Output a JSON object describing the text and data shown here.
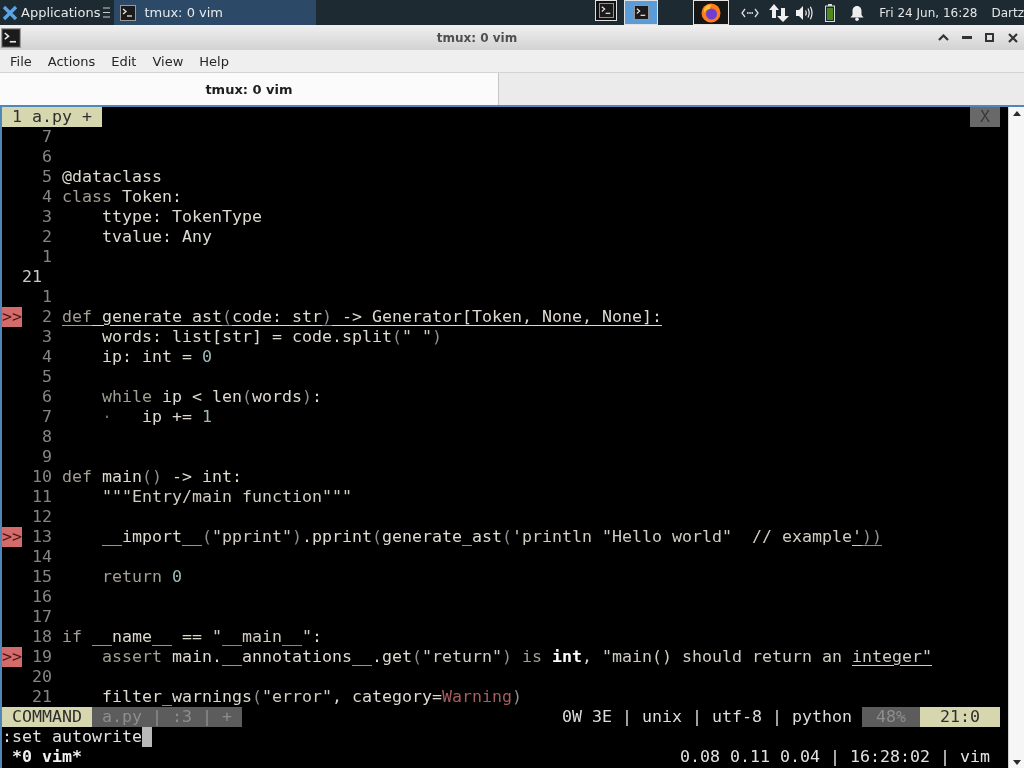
{
  "top_panel": {
    "applications_label": "Applications",
    "taskbar": [
      {
        "label": "tmux: 0 vim",
        "selected": true
      }
    ],
    "workspaces": [
      {
        "selected": false
      },
      {
        "selected": true
      }
    ],
    "clock": "Fri 24 Jun, 16:28",
    "user": "Dartz"
  },
  "window": {
    "title": "tmux: 0 vim"
  },
  "menu": [
    "File",
    "Actions",
    "Edit",
    "View",
    "Help"
  ],
  "tabs": [
    {
      "label": "tmux: 0 vim",
      "selected": true
    }
  ],
  "vim": {
    "tabline": {
      "tabs": [
        {
          "label": "1 a.py +",
          "selected": true
        }
      ],
      "close": "X"
    },
    "lines": [
      {
        "number": "7",
        "current": false
      },
      {
        "number": "6",
        "current": false
      },
      {
        "number": "5",
        "current": false,
        "tokens": [
          {
            "text": "@dataclass",
            "kind": "plain",
            "underline": false
          }
        ]
      },
      {
        "number": "4",
        "current": false,
        "tokens": [
          {
            "text": "class",
            "kind": "keyword",
            "underline": false
          },
          {
            "text": " Token:",
            "kind": "plain",
            "underline": false
          }
        ]
      },
      {
        "number": "3",
        "current": false,
        "tokens": [
          {
            "text": "    ttype: TokenType",
            "kind": "plain",
            "underline": false
          }
        ]
      },
      {
        "number": "2",
        "current": false,
        "tokens": [
          {
            "text": "    tvalue: Any",
            "kind": "plain",
            "underline": false
          }
        ]
      },
      {
        "number": "1",
        "current": false
      },
      {
        "number": "21",
        "current": true
      },
      {
        "number": "1",
        "current": false
      },
      {
        "sign": ">>",
        "number": "2",
        "current": false,
        "tokens": [
          {
            "text": "def",
            "kind": "keyword",
            "underline": true
          },
          {
            "text": " generate_ast",
            "kind": "plain",
            "underline": true
          },
          {
            "text": "(",
            "kind": "paren",
            "underline": true
          },
          {
            "text": "code: str",
            "kind": "plain",
            "underline": true
          },
          {
            "text": ")",
            "kind": "paren",
            "underline": true
          },
          {
            "text": " -> Generator[Token, None, None]:",
            "kind": "plain",
            "underline": true
          }
        ]
      },
      {
        "number": "3",
        "current": false,
        "tokens": [
          {
            "text": "    words: list[str] = code.split",
            "kind": "plain",
            "underline": false
          },
          {
            "text": "(",
            "kind": "paren",
            "underline": false
          },
          {
            "text": "\" \"",
            "kind": "string",
            "underline": false
          },
          {
            "text": ")",
            "kind": "paren",
            "underline": false
          }
        ]
      },
      {
        "number": "4",
        "current": false,
        "tokens": [
          {
            "text": "    ip: int = ",
            "kind": "plain",
            "underline": false
          },
          {
            "text": "0",
            "kind": "number",
            "underline": false
          }
        ]
      },
      {
        "number": "5",
        "current": false
      },
      {
        "number": "6",
        "current": false,
        "tokens": [
          {
            "text": "    while",
            "kind": "keyword",
            "underline": false
          },
          {
            "text": " ip < len",
            "kind": "plain",
            "underline": false
          },
          {
            "text": "(",
            "kind": "paren",
            "underline": false
          },
          {
            "text": "words",
            "kind": "plain",
            "underline": false
          },
          {
            "text": ")",
            "kind": "paren",
            "underline": false
          },
          {
            "text": ":",
            "kind": "plain",
            "underline": false
          }
        ]
      },
      {
        "number": "7",
        "current": false,
        "tokens": [
          {
            "text": "    ·",
            "kind": "listchar",
            "underline": false
          },
          {
            "text": "   ip += ",
            "kind": "plain",
            "underline": false
          },
          {
            "text": "1",
            "kind": "number",
            "underline": false
          }
        ]
      },
      {
        "number": "8",
        "current": false
      },
      {
        "number": "9",
        "current": false
      },
      {
        "number": "10",
        "current": false,
        "tokens": [
          {
            "text": "def",
            "kind": "keyword",
            "underline": false
          },
          {
            "text": " main",
            "kind": "plain",
            "underline": false
          },
          {
            "text": "()",
            "kind": "paren",
            "underline": false
          },
          {
            "text": " -> int:",
            "kind": "plain",
            "underline": false
          }
        ]
      },
      {
        "number": "11",
        "current": false,
        "tokens": [
          {
            "text": "    \"\"\"Entry/main function\"\"\"",
            "kind": "string",
            "underline": false
          }
        ]
      },
      {
        "number": "12",
        "current": false
      },
      {
        "sign": ">>",
        "number": "13",
        "current": false,
        "tokens": [
          {
            "text": "    __import__",
            "kind": "plain",
            "underline": false
          },
          {
            "text": "(",
            "kind": "paren",
            "underline": false
          },
          {
            "text": "\"pprint\"",
            "kind": "string",
            "underline": false
          },
          {
            "text": ")",
            "kind": "paren",
            "underline": false
          },
          {
            "text": ".pprint",
            "kind": "plain",
            "underline": false
          },
          {
            "text": "(",
            "kind": "paren",
            "underline": false
          },
          {
            "text": "generate_ast",
            "kind": "plain",
            "underline": false
          },
          {
            "text": "(",
            "kind": "paren",
            "underline": false
          },
          {
            "text": "'println \"Hello world\"  // example",
            "kind": "string",
            "underline": false
          },
          {
            "text": "'",
            "kind": "string",
            "underline": true
          },
          {
            "text": "))",
            "kind": "paren",
            "underline": true
          }
        ]
      },
      {
        "number": "14",
        "current": false
      },
      {
        "number": "15",
        "current": false,
        "tokens": [
          {
            "text": "    return",
            "kind": "keyword",
            "underline": false
          },
          {
            "text": " 0",
            "kind": "number",
            "underline": false
          }
        ]
      },
      {
        "number": "16",
        "current": false
      },
      {
        "number": "17",
        "current": false
      },
      {
        "number": "18",
        "current": false,
        "tokens": [
          {
            "text": "if",
            "kind": "keyword",
            "underline": false
          },
          {
            "text": " __name__ == ",
            "kind": "plain",
            "underline": false
          },
          {
            "text": "\"__main__\"",
            "kind": "string",
            "underline": false
          },
          {
            "text": ":",
            "kind": "plain",
            "underline": false
          }
        ]
      },
      {
        "sign": ">>",
        "number": "19",
        "current": false,
        "tokens": [
          {
            "text": "    assert",
            "kind": "keyword",
            "underline": false
          },
          {
            "text": " main.__annotations__.get",
            "kind": "plain",
            "underline": false
          },
          {
            "text": "(",
            "kind": "paren",
            "underline": false
          },
          {
            "text": "\"return\"",
            "kind": "string",
            "underline": false
          },
          {
            "text": ")",
            "kind": "paren",
            "underline": false
          },
          {
            "text": " is",
            "kind": "keyword",
            "underline": false
          },
          {
            "text": " int",
            "kind": "builtin",
            "underline": false
          },
          {
            "text": ", ",
            "kind": "plain",
            "underline": false
          },
          {
            "text": "\"main() should return an ",
            "kind": "string",
            "underline": false
          },
          {
            "text": "integer\"",
            "kind": "string",
            "underline": true
          }
        ]
      },
      {
        "number": "20",
        "current": false
      },
      {
        "number": "21",
        "current": false,
        "tokens": [
          {
            "text": "    filter_warnings",
            "kind": "plain",
            "underline": false
          },
          {
            "text": "(",
            "kind": "paren",
            "underline": false
          },
          {
            "text": "\"error\"",
            "kind": "string",
            "underline": false
          },
          {
            "text": ", category=",
            "kind": "plain",
            "underline": false
          },
          {
            "text": "Warning",
            "kind": "exception",
            "underline": false
          },
          {
            "text": ")",
            "kind": "paren",
            "underline": false
          }
        ]
      }
    ],
    "statusline": {
      "mode": "COMMAND",
      "file": "a.py | :3 | +",
      "info": "0W 3E | unix | utf-8 | python",
      "percent": "48%",
      "position": "21:0"
    },
    "command_line": ":set autowrite"
  },
  "tmux_status": {
    "window": "*0 vim*",
    "info": "0.08 0.11 0.04 | 16:28:02 | vim"
  }
}
